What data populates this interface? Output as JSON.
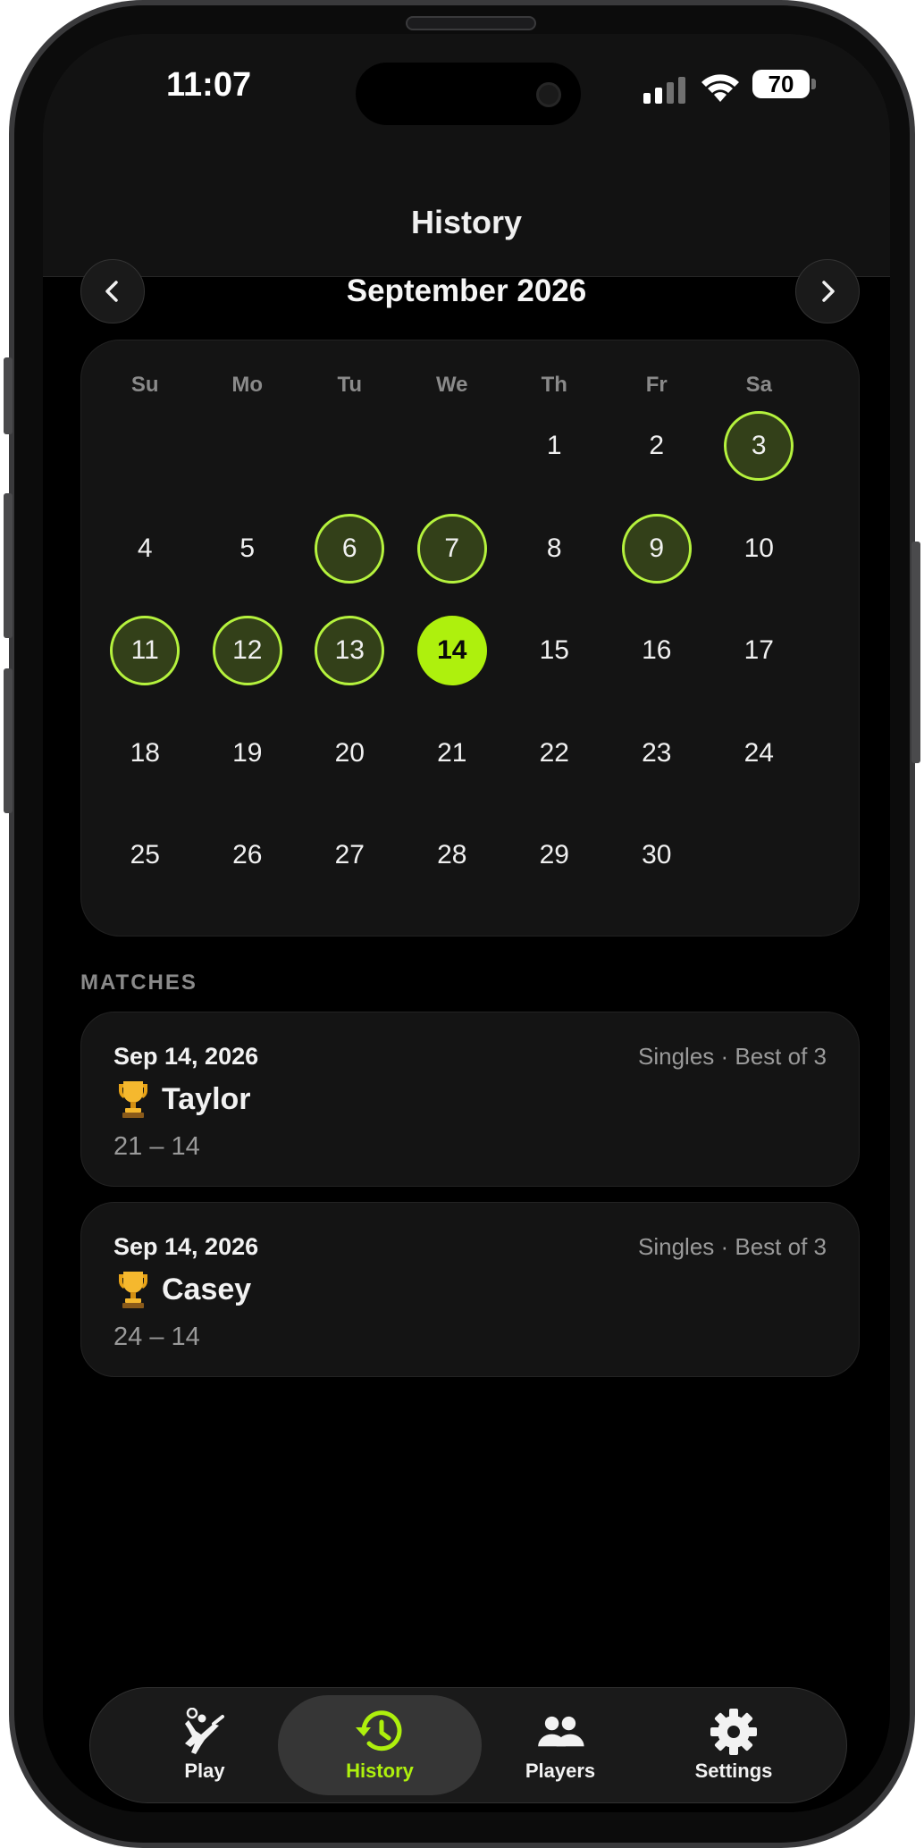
{
  "status_bar": {
    "time": "11:07",
    "battery": "70"
  },
  "nav": {
    "title": "History"
  },
  "calendar": {
    "month_label": "September 2026",
    "weekdays": [
      "Su",
      "Mo",
      "Tu",
      "We",
      "Th",
      "Fr",
      "Sa"
    ],
    "days": [
      "1",
      "2",
      "3",
      "4",
      "5",
      "6",
      "7",
      "8",
      "9",
      "10",
      "11",
      "12",
      "13",
      "14",
      "15",
      "16",
      "17",
      "18",
      "19",
      "20",
      "21",
      "22",
      "23",
      "24",
      "25",
      "26",
      "27",
      "28",
      "29",
      "30"
    ],
    "first_weekday_index": 4,
    "played_days": [
      3,
      6,
      7,
      9,
      11,
      12,
      13
    ],
    "selected_day": 14
  },
  "matches": {
    "section_label": "MATCHES",
    "items": [
      {
        "date": "Sep 14, 2026",
        "format": "Singles · Best of 3",
        "winner": "Taylor",
        "score": "21 – 14"
      },
      {
        "date": "Sep 14, 2026",
        "format": "Singles · Best of 3",
        "winner": "Casey",
        "score": "24 – 14"
      }
    ]
  },
  "tabs": [
    {
      "label": "Play",
      "icon": "volleyball-player-icon",
      "active": false
    },
    {
      "label": "History",
      "icon": "history-clock-icon",
      "active": true
    },
    {
      "label": "Players",
      "icon": "players-icon",
      "active": false
    },
    {
      "label": "Settings",
      "icon": "gear-icon",
      "active": false
    }
  ],
  "colors": {
    "accent": "#aef00d",
    "played_fill": "#334019",
    "played_ring": "#b5f23d",
    "background": "#000000",
    "card": "#141414"
  }
}
